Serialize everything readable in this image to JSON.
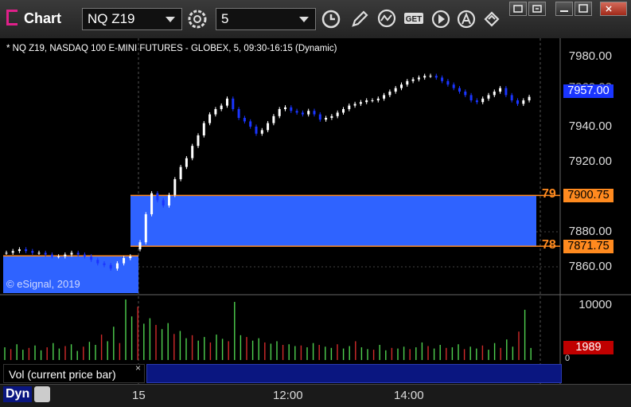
{
  "app": {
    "title": "Chart"
  },
  "toolbar": {
    "symbol": "NQ Z19",
    "interval": "5",
    "icons": [
      "settings-gear-icon",
      "clock-icon",
      "pencil-icon",
      "study-icon",
      "get-icon",
      "play-icon",
      "autoscale-icon",
      "link-icon"
    ]
  },
  "window_controls": [
    "restore-icon",
    "unpin-icon",
    "minimize-icon",
    "maximize-icon",
    "close-icon"
  ],
  "chart": {
    "header": "* NQ Z19, NASDAQ 100 E-MINI FUTURES - GLOBEX, 5, 09:30-16:15 (Dynamic)",
    "copyright": "© eSignal, 2019",
    "price_axis": [
      "7980.00",
      "7960.00",
      "7940.00",
      "7920.00",
      "7900.00",
      "7880.00",
      "7860.00"
    ],
    "last_price_tag": "7957.00",
    "level_tags": [
      {
        "label": "79",
        "value": "7900.75"
      },
      {
        "label": "78",
        "value": "7871.75"
      }
    ],
    "volume_axis_top": "10000",
    "volume_last_tag": "1989",
    "volume_zero": "0",
    "volume_label": "Vol (current price bar)",
    "volume_close": "×",
    "time_axis": [
      "15",
      "12:00",
      "14:00"
    ],
    "footer_mode": "Dyn"
  },
  "colors": {
    "up_candle": "#ffffff",
    "down_candle": "#1a35ff",
    "gap_fill": "#2f63ff",
    "level_line": "#ff8a1f",
    "last_price_tag_bg": "#1a35ff",
    "level_tag_bg": "#ff8a1f",
    "vol_up": "#4fd24f",
    "vol_down": "#d22a2a"
  },
  "chart_data": {
    "type": "candlestick",
    "title": "NQ Z19, NASDAQ 100 E-MINI FUTURES - GLOBEX, 5, 09:30-16:15 (Dynamic)",
    "ylim": [
      7845,
      7985
    ],
    "x_ticks": [
      "15",
      "12:00",
      "14:00"
    ],
    "prev_session_close": [
      7868,
      7869,
      7870,
      7869,
      7868,
      7868,
      7867,
      7866,
      7866,
      7867,
      7868,
      7867,
      7866,
      7864,
      7862,
      7861,
      7859,
      7862,
      7865,
      7866
    ],
    "session_close": [
      7874,
      7890,
      7902,
      7898,
      7895,
      7901,
      7910,
      7917,
      7922,
      7929,
      7935,
      7942,
      7947,
      7950,
      7952,
      7956,
      7950,
      7945,
      7943,
      7940,
      7936,
      7938,
      7942,
      7946,
      7950,
      7951,
      7949,
      7948,
      7947,
      7949,
      7947,
      7944,
      7945,
      7946,
      7948,
      7950,
      7952,
      7953,
      7954,
      7955,
      7955,
      7956,
      7958,
      7960,
      7962,
      7964,
      7966,
      7967,
      7968,
      7969,
      7969,
      7968,
      7966,
      7964,
      7962,
      7960,
      7958,
      7955,
      7954,
      7956,
      7958,
      7960,
      7962,
      7958,
      7955,
      7953,
      7955,
      7957
    ],
    "gap": {
      "top": 7900.75,
      "bottom": 7871.75
    },
    "volume": [
      2100,
      1800,
      2600,
      1700,
      2000,
      2400,
      1600,
      2100,
      2800,
      1900,
      2300,
      2600,
      1500,
      2200,
      3000,
      2500,
      4200,
      3100,
      5500,
      2800,
      10000,
      7200,
      8800,
      6000,
      6900,
      5800,
      5100,
      6100,
      4300,
      4800,
      3600,
      4100,
      3200,
      3800,
      2900,
      4200,
      3500,
      3100,
      9600,
      4100,
      3800,
      3200,
      3600,
      2900,
      2700,
      3100,
      2500,
      2600,
      2300,
      2400,
      2100,
      2800,
      2500,
      2200,
      2000,
      2600,
      1900,
      2300,
      3100,
      2100,
      1800,
      1700,
      2500,
      1600,
      2000,
      1900,
      2200,
      1800,
      2100,
      2900,
      2300,
      1900,
      2500,
      2000,
      2100,
      2600,
      1800,
      2200,
      1900,
      2400,
      1700,
      2800,
      2000,
      3400,
      2200,
      4700,
      8300,
      1989
    ]
  }
}
